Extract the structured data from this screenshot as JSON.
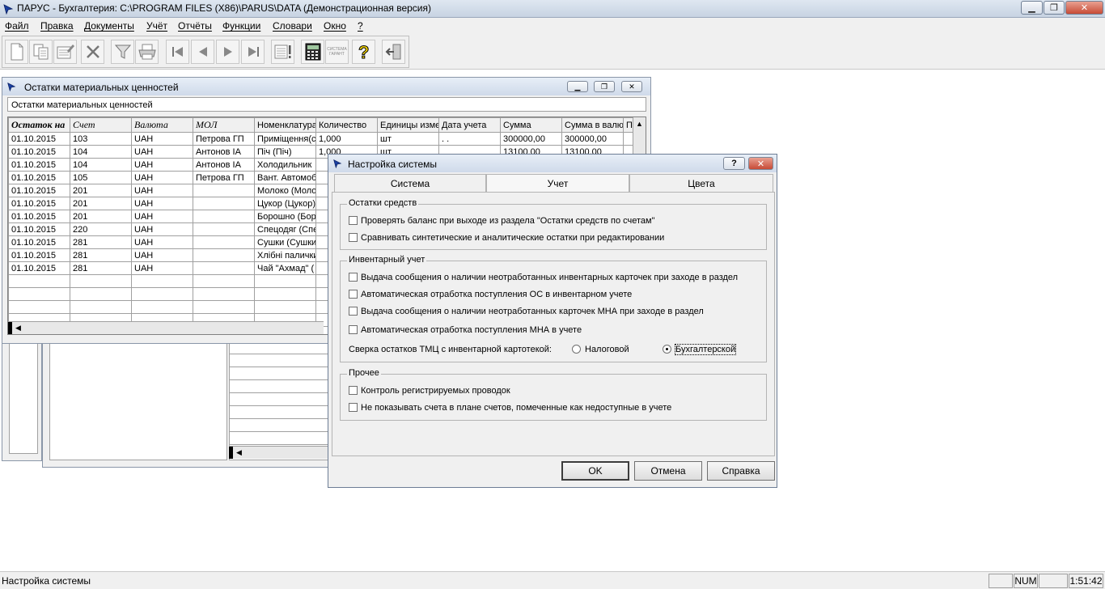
{
  "app": {
    "title": "ПАРУС - Бухгалтерия: C:\\PROGRAM FILES (X86)\\PARUS\\DATA (Демонстрационная версия)"
  },
  "menu": [
    "Файл",
    "Правка",
    "Документы",
    "Учёт",
    "Отчёты",
    "Функции",
    "Словари",
    "Окно",
    "?"
  ],
  "toolbar": {
    "icons": [
      "new-doc-icon",
      "copy-doc-icon",
      "edit-doc-icon",
      "delete-icon",
      "filter-icon",
      "print-icon",
      "first-record-icon",
      "prev-record-icon",
      "next-record-icon",
      "last-record-icon",
      "report-icon",
      "calculator-icon",
      "garant-icon",
      "help-icon",
      "exit-icon"
    ],
    "garant_label": "СИСТЕМА ГАРАНТ"
  },
  "mw": {
    "title": "Остатки материальных ценностей",
    "caption": "Остатки материальных ценностей",
    "columns": [
      "Остаток на",
      "Счет",
      "Валюта",
      "МОЛ",
      "Номенклатура",
      "Количество",
      "Единицы изме",
      "Дата учета",
      "Сумма",
      "Сумма в валют",
      "П"
    ],
    "rows": [
      [
        "01.10.2015",
        "103",
        "UAH",
        "Петрова ГП",
        "Приміщення(с",
        "1,000",
        "шт",
        ". .",
        "300000,00",
        "300000,00"
      ],
      [
        "01.10.2015",
        "104",
        "UAH",
        "Антонов ІА",
        "Піч (Піч)",
        "1,000",
        "шт",
        "",
        "13100,00",
        "13100,00"
      ],
      [
        "01.10.2015",
        "104",
        "UAH",
        "Антонов ІА",
        "Холодильник"
      ],
      [
        "01.10.2015",
        "105",
        "UAH",
        "Петрова ГП",
        "Вант. Автомоб"
      ],
      [
        "01.10.2015",
        "201",
        "UAH",
        "",
        "Молоко (Моло"
      ],
      [
        "01.10.2015",
        "201",
        "UAH",
        "",
        "Цукор (Цукор)"
      ],
      [
        "01.10.2015",
        "201",
        "UAH",
        "",
        "Борошно (Бор"
      ],
      [
        "01.10.2015",
        "220",
        "UAH",
        "",
        "Спецодяг (Спе"
      ],
      [
        "01.10.2015",
        "281",
        "UAH",
        "",
        "Сушки (Сушки"
      ],
      [
        "01.10.2015",
        "281",
        "UAH",
        "",
        "Хлібні палички"
      ],
      [
        "01.10.2015",
        "281",
        "UAH",
        "",
        "Чай \"Ахмад\" ("
      ]
    ]
  },
  "dialog": {
    "title": "Настройка системы",
    "tabs": [
      "Система",
      "Учет",
      "Цвета"
    ],
    "active_tab": "Учет",
    "group1": {
      "title": "Остатки средств",
      "items": [
        "Проверять баланс при выходе из раздела \"Остатки средств по счетам\"",
        "Сравнивать синтетические и аналитические остатки при редактировании"
      ]
    },
    "group2": {
      "title": "Инвентарный учет",
      "items": [
        "Выдача сообщения о наличии неотработанных инвентарных карточек при заходе в раздел",
        "Автоматическая отработка поступления ОС в инвентарном учете",
        "Выдача сообщения о наличии неотработанных карточек МНА при заходе в раздел",
        "Автоматическая отработка поступления МНА в учете"
      ],
      "radio_label": "Сверка остатков ТМЦ с инвентарной картотекой:",
      "radio_opt1": "Налоговой",
      "radio_opt2": "Бухгалтерской",
      "radio_selected": "Бухгалтерской"
    },
    "group3": {
      "title": "Прочее",
      "items": [
        "Контроль регистрируемых проводок",
        "Не показывать счета в плане счетов, помеченные как недоступные в учете"
      ]
    },
    "ok_label": "OK",
    "cancel_label": "Отмена",
    "help_label": "Справка"
  },
  "status": {
    "text": "Настройка системы",
    "num": "NUM",
    "time": "1:51:42"
  }
}
